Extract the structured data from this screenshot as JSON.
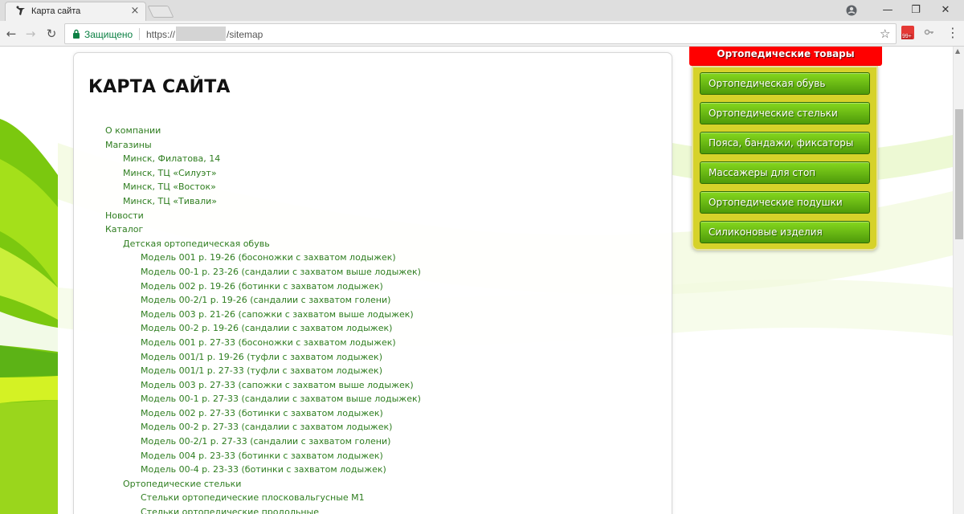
{
  "browser": {
    "tab_title": "Карта сайта",
    "tab_close": "×",
    "secure_label": "Защищено",
    "url_scheme": "https://",
    "url_path": "/sitemap",
    "extension_badge": "99+",
    "back": "←",
    "forward": "→",
    "reload": "↻",
    "star": "☆",
    "menu": "⋮",
    "minimize": "—",
    "maximize": "❐",
    "close": "✕"
  },
  "page": {
    "title": "КАРТА САЙТА"
  },
  "sitemap": [
    {
      "level": 0,
      "label": "О компании"
    },
    {
      "level": 0,
      "label": "Магазины"
    },
    {
      "level": 1,
      "label": "Минск, Филатова, 14"
    },
    {
      "level": 1,
      "label": "Минск, ТЦ «Силуэт»"
    },
    {
      "level": 1,
      "label": "Минск, ТЦ «Восток»"
    },
    {
      "level": 1,
      "label": "Минск, ТЦ «Тивали»"
    },
    {
      "level": 0,
      "label": "Новости"
    },
    {
      "level": 0,
      "label": "Каталог"
    },
    {
      "level": 1,
      "label": "Детская ортопедическая обувь"
    },
    {
      "level": 2,
      "label": "Модель 001 р. 19-26 (босоножки с захватом лодыжек)"
    },
    {
      "level": 2,
      "label": "Модель 00-1 р. 23-26 (сандалии с захватом выше лодыжек)"
    },
    {
      "level": 2,
      "label": "Модель 002 р. 19-26 (ботинки с захватом лодыжек)"
    },
    {
      "level": 2,
      "label": "Модель 00-2/1 р. 19-26 (сандалии с захватом голени)"
    },
    {
      "level": 2,
      "label": "Модель 003 р. 21-26 (сапожки с захватом выше лодыжек)"
    },
    {
      "level": 2,
      "label": "Модель 00-2 р. 19-26 (сандалии с захватом лодыжек)"
    },
    {
      "level": 2,
      "label": "Модель 001 р. 27-33 (босоножки с захватом лодыжек)"
    },
    {
      "level": 2,
      "label": "Модель 001/1 р. 19-26 (туфли с захватом лодыжек)"
    },
    {
      "level": 2,
      "label": "Модель 001/1 р. 27-33 (туфли с захватом лодыжек)"
    },
    {
      "level": 2,
      "label": "Модель 003 р. 27-33 (сапожки с захватом выше лодыжек)"
    },
    {
      "level": 2,
      "label": "Модель 00-1 р. 27-33 (сандалии с захватом выше лодыжек)"
    },
    {
      "level": 2,
      "label": "Модель 002 р. 27-33 (ботинки с захватом лодыжек)"
    },
    {
      "level": 2,
      "label": "Модель 00-2 р. 27-33 (сандалии с захватом лодыжек)"
    },
    {
      "level": 2,
      "label": "Модель 00-2/1 р. 27-33 (сандалии с захватом голени)"
    },
    {
      "level": 2,
      "label": "Модель 004 р. 23-33 (ботинки с захватом лодыжек)"
    },
    {
      "level": 2,
      "label": "Модель 00-4 р. 23-33 (ботинки с захватом лодыжек)"
    },
    {
      "level": 1,
      "label": "Ортопедические стельки"
    },
    {
      "level": 2,
      "label": "Стельки ортопедические плосковальгусные М1"
    },
    {
      "level": 2,
      "label": "Стельки ортопедические продольные"
    }
  ],
  "sidebar": {
    "header": "Ортопедические товары",
    "items": [
      {
        "label": "Ортопедическая обувь"
      },
      {
        "label": "Ортопедические стельки"
      },
      {
        "label": "Пояса, бандажи, фиксаторы"
      },
      {
        "label": "Массажеры для стоп"
      },
      {
        "label": "Ортопедические подушки"
      },
      {
        "label": "Силиконовые изделия"
      }
    ]
  },
  "colors": {
    "link_green": "#2e7d1f",
    "sidebar_header_red": "#ff0000",
    "sidebar_box_yellow": "#d6d22a",
    "button_green": "#5cb312",
    "secure_green": "#0b8043"
  }
}
